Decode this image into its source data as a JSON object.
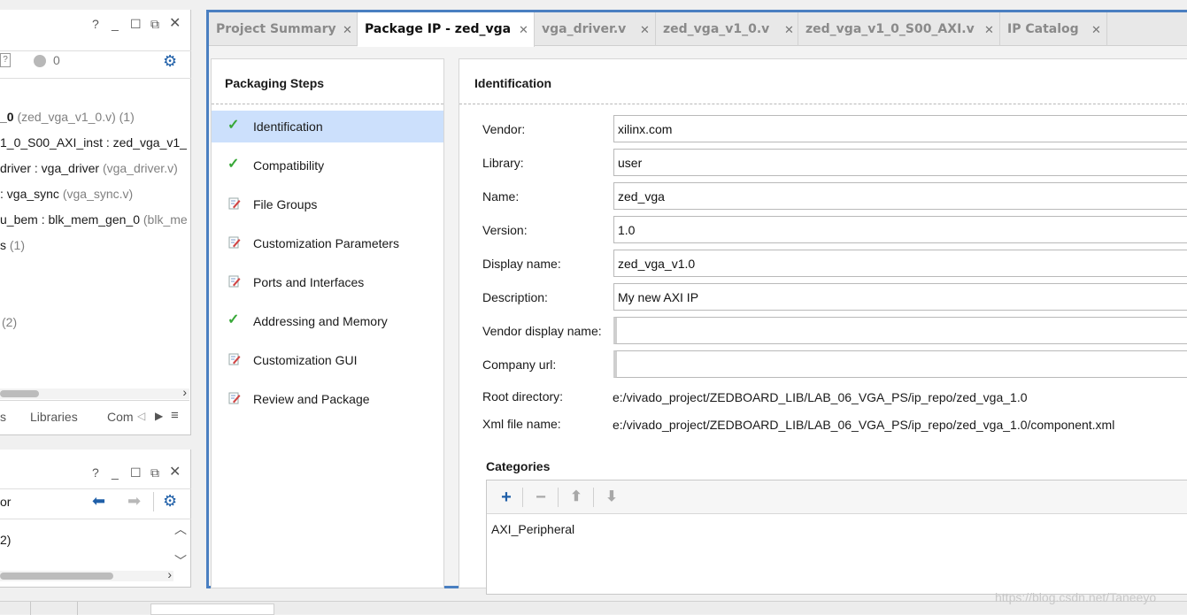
{
  "top_panel": {
    "help": "?",
    "badge_count": "0",
    "tree": [
      {
        "name": "_0",
        "meta": "(zed_vga_v1_0.v) (1)"
      },
      {
        "name": "1_0_S00_AXI_inst : zed_vga_v1_",
        "meta": ""
      },
      {
        "name": "driver : vga_driver",
        "meta": "(vga_driver.v)"
      },
      {
        "name": ": vga_sync",
        "meta": "(vga_sync.v)"
      },
      {
        "name": "u_bem : blk_mem_gen_0",
        "meta": "(blk_me"
      },
      {
        "name": "s",
        "meta": "(1)"
      },
      {
        "name": "",
        "meta": "(2)"
      }
    ],
    "bottom_tabs": [
      "s",
      "Libraries",
      "Com"
    ]
  },
  "bottom_panel": {
    "help": "?",
    "label": "or",
    "tree_item": "2)"
  },
  "tabs": [
    {
      "label": "Project Summary",
      "active": false
    },
    {
      "label": "Package IP - zed_vga",
      "active": true
    },
    {
      "label": "vga_driver.v",
      "active": false
    },
    {
      "label": "zed_vga_v1_0.v",
      "active": false
    },
    {
      "label": "zed_vga_v1_0_S00_AXI.v",
      "active": false
    },
    {
      "label": "IP Catalog",
      "active": false
    }
  ],
  "steps": {
    "title": "Packaging Steps",
    "items": [
      {
        "label": "Identification",
        "status": "done",
        "selected": true
      },
      {
        "label": "Compatibility",
        "status": "done",
        "selected": false
      },
      {
        "label": "File Groups",
        "status": "edit",
        "selected": false
      },
      {
        "label": "Customization Parameters",
        "status": "edit",
        "selected": false
      },
      {
        "label": "Ports and Interfaces",
        "status": "edit",
        "selected": false
      },
      {
        "label": "Addressing and Memory",
        "status": "done",
        "selected": false
      },
      {
        "label": "Customization GUI",
        "status": "edit",
        "selected": false
      },
      {
        "label": "Review and Package",
        "status": "edit",
        "selected": false
      }
    ]
  },
  "identification": {
    "title": "Identification",
    "fields": [
      {
        "label": "Vendor:",
        "value": "xilinx.com"
      },
      {
        "label": "Library:",
        "value": "user"
      },
      {
        "label": "Name:",
        "value": "zed_vga"
      },
      {
        "label": "Version:",
        "value": "1.0"
      },
      {
        "label": "Display name:",
        "value": "zed_vga_v1.0"
      },
      {
        "label": "Description:",
        "value": "My new AXI IP"
      },
      {
        "label": "Vendor display name:",
        "value": ""
      },
      {
        "label": "Company url:",
        "value": ""
      }
    ],
    "root_directory_label": "Root directory:",
    "root_directory": "e:/vivado_project/ZEDBOARD_LIB/LAB_06_VGA_PS/ip_repo/zed_vga_1.0",
    "xml_file_label": "Xml file name:",
    "xml_file": "e:/vivado_project/ZEDBOARD_LIB/LAB_06_VGA_PS/ip_repo/zed_vga_1.0/component.xml"
  },
  "categories": {
    "title": "Categories",
    "items": [
      "AXI_Peripheral"
    ]
  },
  "watermark": "https://blog.csdn.net/Taneeyo",
  "colors": {
    "accent": "#4a7fc1",
    "selected": "#cce0fc",
    "check": "#38a838"
  }
}
